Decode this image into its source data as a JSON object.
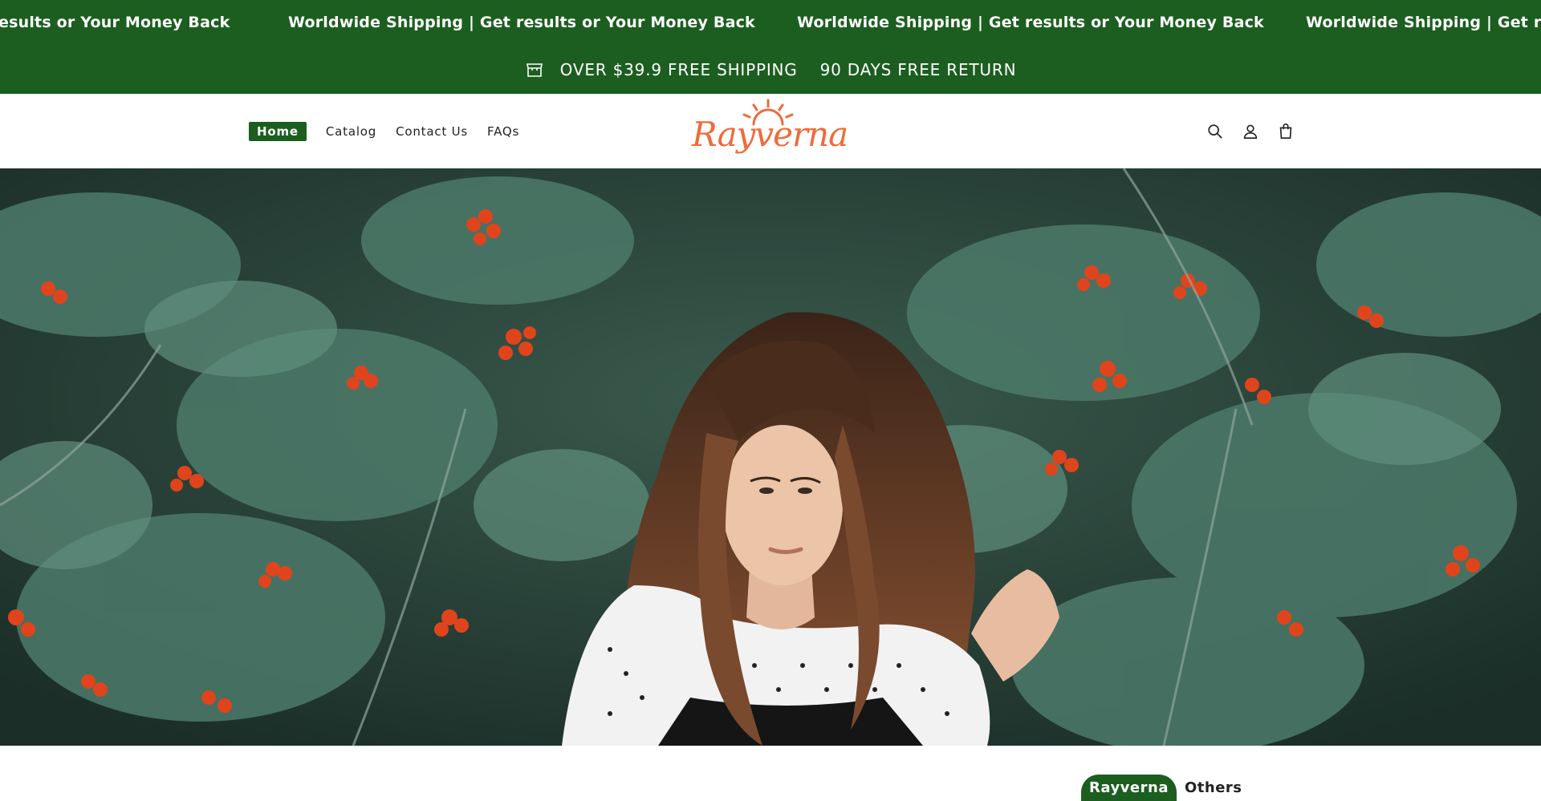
{
  "marquee": {
    "items": [
      "esults or Your Money Back",
      "Worldwide Shipping | Get results or Your Money Back",
      "Worldwide Shipping | Get results or Your Money Back",
      "Worldwide Shipping | Get resu"
    ]
  },
  "promo": {
    "icon": "store-icon",
    "shipping_text": "OVER $39.9 FREE SHIPPING",
    "return_text": "90 DAYS FREE RETURN"
  },
  "nav": {
    "items": [
      {
        "label": "Home",
        "active": true
      },
      {
        "label": "Catalog",
        "active": false
      },
      {
        "label": "Contact Us",
        "active": false
      },
      {
        "label": "FAQs",
        "active": false
      }
    ]
  },
  "logo": {
    "text": "Rayverna",
    "color": "#ee6b3a"
  },
  "header_icons": [
    "search-icon",
    "account-icon",
    "cart-icon"
  ],
  "hero": {
    "image": "woman-with-curly-hair-among-rowan-berries"
  },
  "tabs": [
    {
      "label": "Rayverna",
      "active": true
    },
    {
      "label": "Others",
      "active": false
    }
  ],
  "colors": {
    "brand_green": "#1c5e20",
    "logo_orange": "#ee6b3a",
    "background": "#ffffff"
  }
}
